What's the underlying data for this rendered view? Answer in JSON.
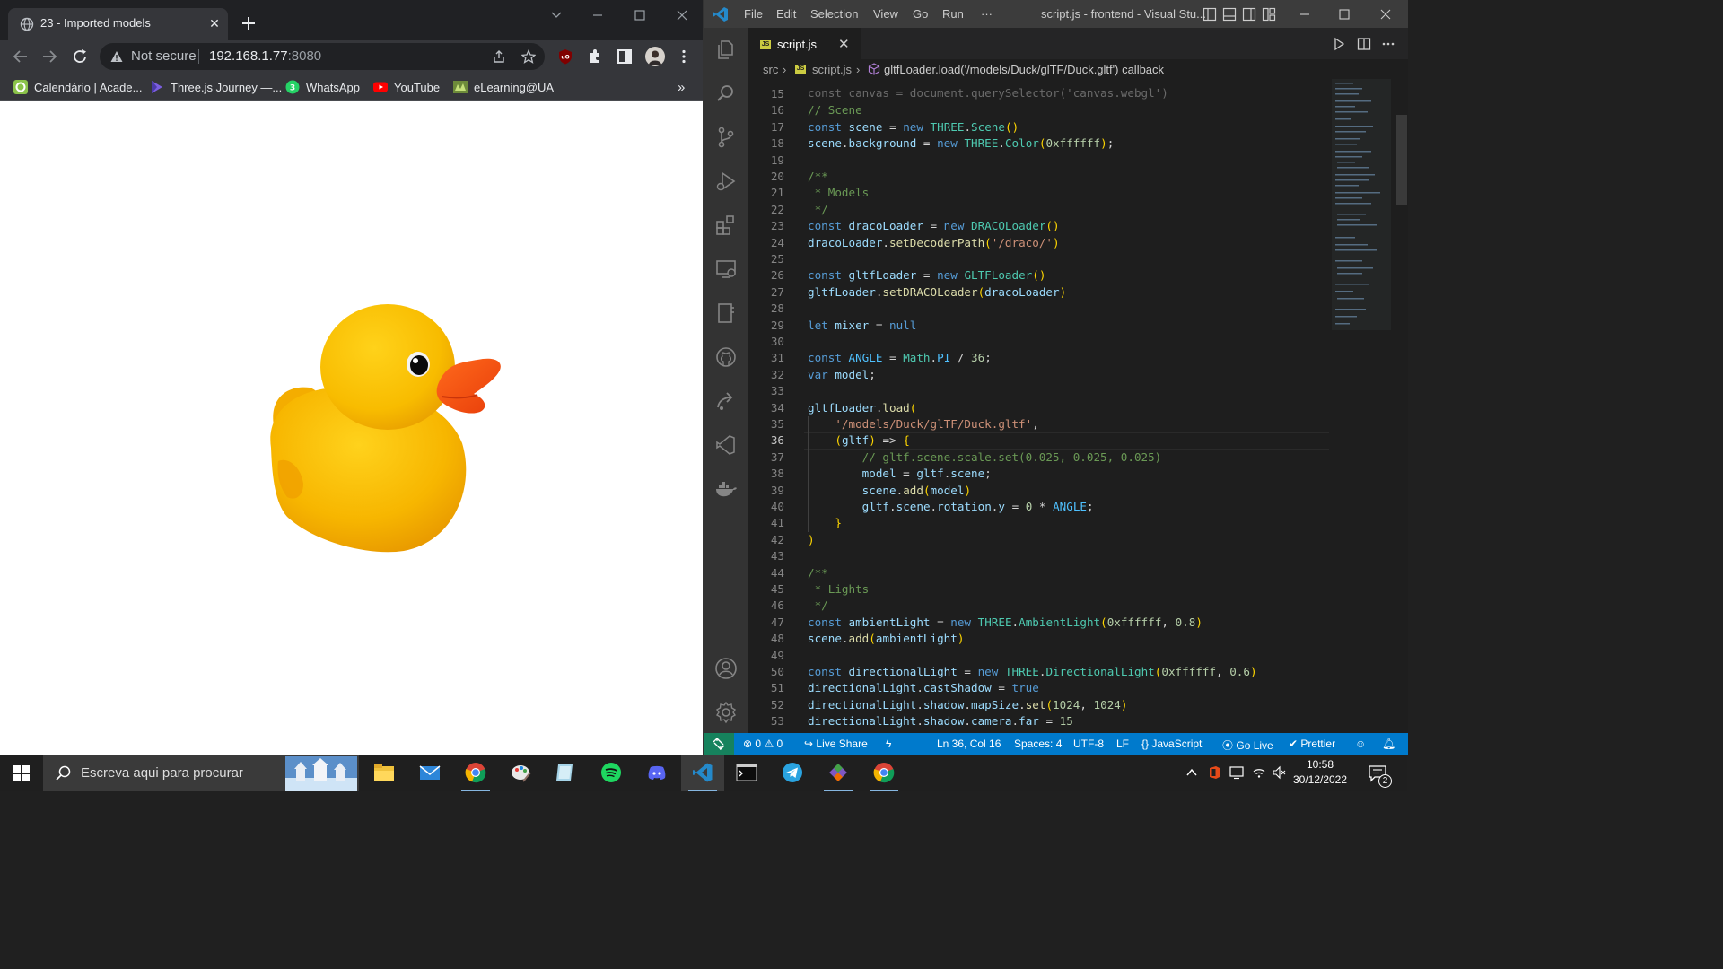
{
  "chrome": {
    "tab_title": "23 - Imported models",
    "omnibox": {
      "security_label": "Not secure",
      "host": "192.168.1.77",
      "port": ":8080"
    },
    "bookmarks": [
      {
        "label": "Calendário | Acade...",
        "icon": "calendar-bookmark-icon"
      },
      {
        "label": "Three.js Journey —...",
        "icon": "threejs-journey-icon"
      },
      {
        "label": "WhatsApp",
        "icon": "whatsapp-icon",
        "badge": "3"
      },
      {
        "label": "YouTube",
        "icon": "youtube-icon"
      },
      {
        "label": "eLearning@UA",
        "icon": "elearning-icon"
      }
    ],
    "bookmarks_overflow": "»",
    "page": {
      "scene_background": "#ffffff",
      "model": "rubber duck"
    }
  },
  "vscode": {
    "menu": [
      "File",
      "Edit",
      "Selection",
      "View",
      "Go",
      "Run",
      "···"
    ],
    "window_title": "script.js - frontend - Visual Stu...",
    "tab": {
      "label": "script.js",
      "lang_badge": "JS",
      "close": "✕"
    },
    "breadcrumb": {
      "folder": "src",
      "file": "script.js",
      "symbol": "gltfLoader.load('/models/Duck/glTF/Duck.gltf') callback"
    },
    "top_partial_line": "const canvas = document.querySelector('canvas.webgl')",
    "current_line": 36,
    "code_lines": [
      {
        "n": "15",
        "text": ""
      },
      {
        "n": "16",
        "text": "// Scene"
      },
      {
        "n": "17",
        "text": "const scene = new THREE.Scene()"
      },
      {
        "n": "18",
        "text": "scene.background = new THREE.Color(0xffffff);"
      },
      {
        "n": "19",
        "text": ""
      },
      {
        "n": "20",
        "text": "/**"
      },
      {
        "n": "21",
        "text": " * Models"
      },
      {
        "n": "22",
        "text": " */"
      },
      {
        "n": "23",
        "text": "const dracoLoader = new DRACOLoader()"
      },
      {
        "n": "24",
        "text": "dracoLoader.setDecoderPath('/draco/')"
      },
      {
        "n": "25",
        "text": ""
      },
      {
        "n": "26",
        "text": "const gltfLoader = new GLTFLoader()"
      },
      {
        "n": "27",
        "text": "gltfLoader.setDRACOLoader(dracoLoader)"
      },
      {
        "n": "28",
        "text": ""
      },
      {
        "n": "29",
        "text": "let mixer = null"
      },
      {
        "n": "30",
        "text": ""
      },
      {
        "n": "31",
        "text": "const ANGLE = Math.PI / 36;"
      },
      {
        "n": "32",
        "text": "var model;"
      },
      {
        "n": "33",
        "text": ""
      },
      {
        "n": "34",
        "text": "gltfLoader.load("
      },
      {
        "n": "35",
        "text": "    '/models/Duck/glTF/Duck.gltf',"
      },
      {
        "n": "36",
        "text": "    (gltf) => {"
      },
      {
        "n": "37",
        "text": "        // gltf.scene.scale.set(0.025, 0.025, 0.025)"
      },
      {
        "n": "38",
        "text": "        model = gltf.scene;"
      },
      {
        "n": "39",
        "text": "        scene.add(model)"
      },
      {
        "n": "40",
        "text": "        gltf.scene.rotation.y = 0 * ANGLE;"
      },
      {
        "n": "41",
        "text": "    }"
      },
      {
        "n": "42",
        "text": ")"
      },
      {
        "n": "43",
        "text": ""
      },
      {
        "n": "44",
        "text": "/**"
      },
      {
        "n": "45",
        "text": " * Lights"
      },
      {
        "n": "46",
        "text": " */"
      },
      {
        "n": "47",
        "text": "const ambientLight = new THREE.AmbientLight(0xffffff, 0.8)"
      },
      {
        "n": "48",
        "text": "scene.add(ambientLight)"
      },
      {
        "n": "49",
        "text": ""
      },
      {
        "n": "50",
        "text": "const directionalLight = new THREE.DirectionalLight(0xffffff, 0.6)"
      },
      {
        "n": "51",
        "text": "directionalLight.castShadow = true"
      },
      {
        "n": "52",
        "text": "directionalLight.shadow.mapSize.set(1024, 1024)"
      },
      {
        "n": "53",
        "text": "directionalLight.shadow.camera.far = 15"
      }
    ],
    "status": {
      "errors": "0",
      "warnings": "0",
      "live_share": "Live Share",
      "cursor": "Ln 36, Col 16",
      "spaces": "Spaces: 4",
      "encoding": "UTF-8",
      "eol": "LF",
      "language": "JavaScript",
      "go_live": "Go Live",
      "prettier": "Prettier"
    },
    "colors": {
      "statusbar": "#007acc",
      "editor": "#1e1e1e",
      "activitybar": "#333333"
    }
  },
  "taskbar": {
    "search_placeholder": "Escreva aqui para procurar",
    "apps": [
      "file-explorer-icon",
      "mail-icon",
      "chrome-icon",
      "paint-icon",
      "notes-icon",
      "spotify-icon",
      "discord-icon",
      "vscode-icon",
      "terminal-icon",
      "telegram-icon",
      "git-client-icon",
      "chrome-alt-icon"
    ],
    "clock_time": "10:58",
    "clock_date": "30/12/2022",
    "notification_count": "2"
  }
}
